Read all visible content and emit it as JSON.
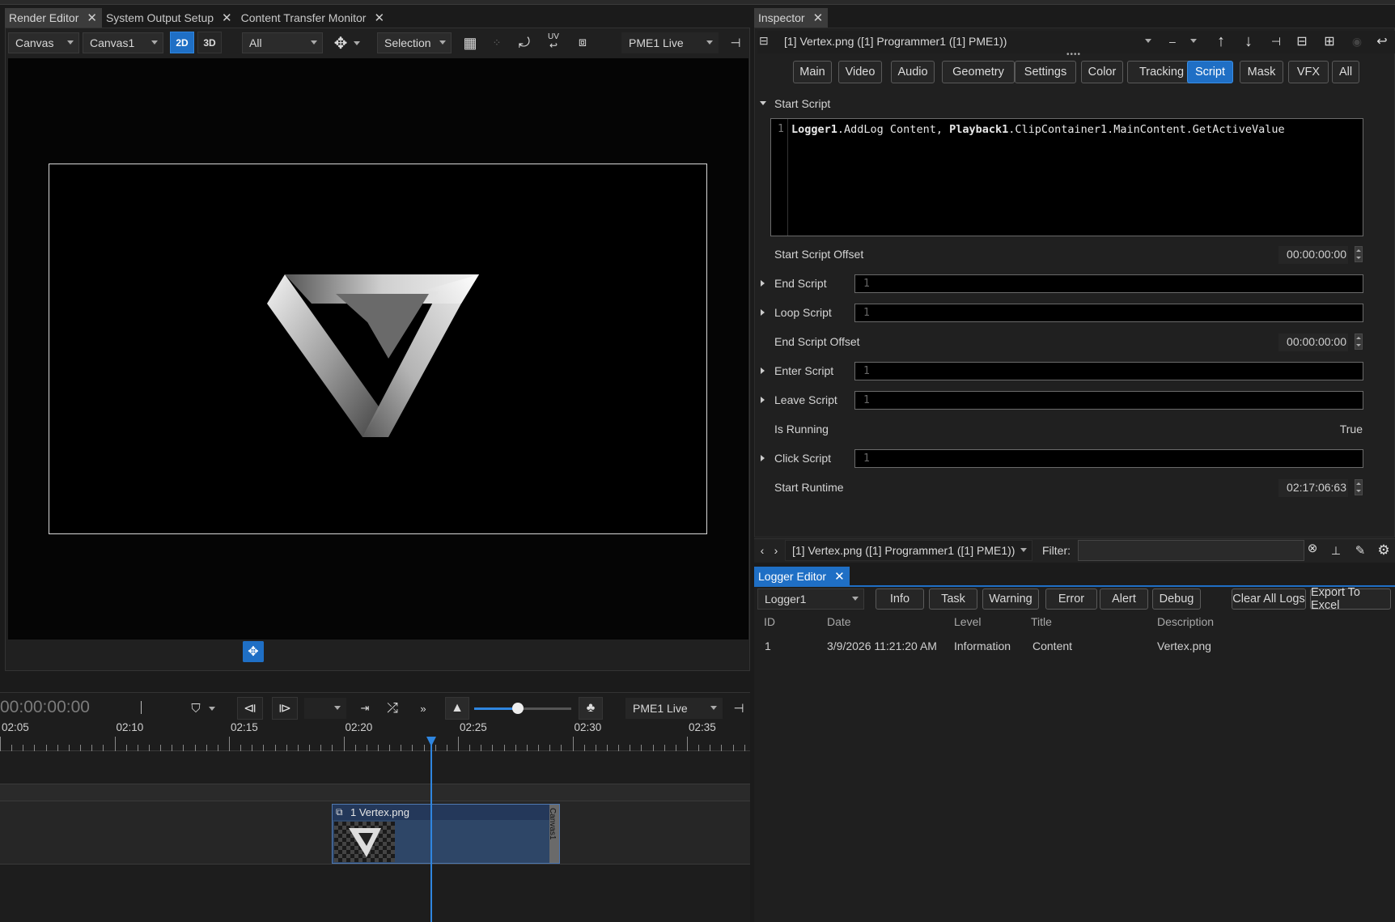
{
  "tabs_left": [
    {
      "label": "Render Editor",
      "active": true
    },
    {
      "label": "System Output Setup"
    },
    {
      "label": "Content Transfer Monitor"
    }
  ],
  "tab_right": {
    "label": "Inspector"
  },
  "render_toolbar": {
    "canvas_mode": "Canvas",
    "canvas_name": "Canvas1",
    "btn_2d": "2D",
    "btn_3d": "3D",
    "layer_filter": "All",
    "tool": "Selection",
    "uv_label": "UV",
    "output": "PME1 Live"
  },
  "inspector": {
    "object": "[1] Vertex.png ([1] Programmer1 ([1] PME1))",
    "minus": "–",
    "tabs": [
      "Main",
      "Video",
      "Audio",
      "Geometry",
      "Settings",
      "Color",
      "Tracking",
      "Script",
      "Mask",
      "VFX",
      "All"
    ],
    "active_tab": "Script",
    "start_script_label": "Start Script",
    "start_script_line": "1",
    "start_script_code": [
      {
        "t": "Logger1",
        "b": true
      },
      {
        "t": ".AddLog Content, ",
        "b": false
      },
      {
        "t": "Playback1",
        "b": true
      },
      {
        "t": ".ClipContainer1.MainContent.GetActiveValue",
        "b": false
      }
    ],
    "start_script_offset_label": "Start Script Offset",
    "start_script_offset": "00:00:00:00",
    "end_script_label": "End Script",
    "loop_script_label": "Loop Script",
    "end_script_offset_label": "End Script Offset",
    "end_script_offset": "00:00:00:00",
    "enter_script_label": "Enter Script",
    "leave_script_label": "Leave Script",
    "is_running_label": "Is Running",
    "is_running": "True",
    "click_script_label": "Click Script",
    "start_runtime_label": "Start Runtime",
    "start_runtime": "02:17:06:63",
    "line_no": "1"
  },
  "nav": {
    "object": "[1] Vertex.png ([1] Programmer1 ([1] PME1))",
    "filter_label": "Filter:",
    "filter_value": ""
  },
  "logger": {
    "tab": "Logger Editor",
    "logger_select": "Logger1",
    "filters": [
      "Info",
      "Task",
      "Warning",
      "Error",
      "Alert",
      "Debug"
    ],
    "clear": "Clear All Logs",
    "export": "Export To Excel",
    "columns": [
      "ID",
      "Date",
      "Level",
      "Title",
      "Description"
    ],
    "rows": [
      {
        "id": "1",
        "date": "3/9/2026 11:21:20 AM",
        "level": "Information",
        "title": "Content",
        "description": "Vertex.png"
      }
    ]
  },
  "timeline": {
    "timecode": "00:00:00:00",
    "output": "PME1 Live",
    "ticks": [
      "02:05",
      "02:10",
      "02:15",
      "02:20",
      "02:25",
      "02:30",
      "02:35"
    ],
    "clip_label": "1 Vertex.png",
    "clip_side": "Canvas1",
    "zoom_level": 0.45
  },
  "colors": {
    "accent": "#1f6fc5",
    "bg": "#1b1b1b",
    "panel": "#202020",
    "clip": "#2e4667"
  }
}
